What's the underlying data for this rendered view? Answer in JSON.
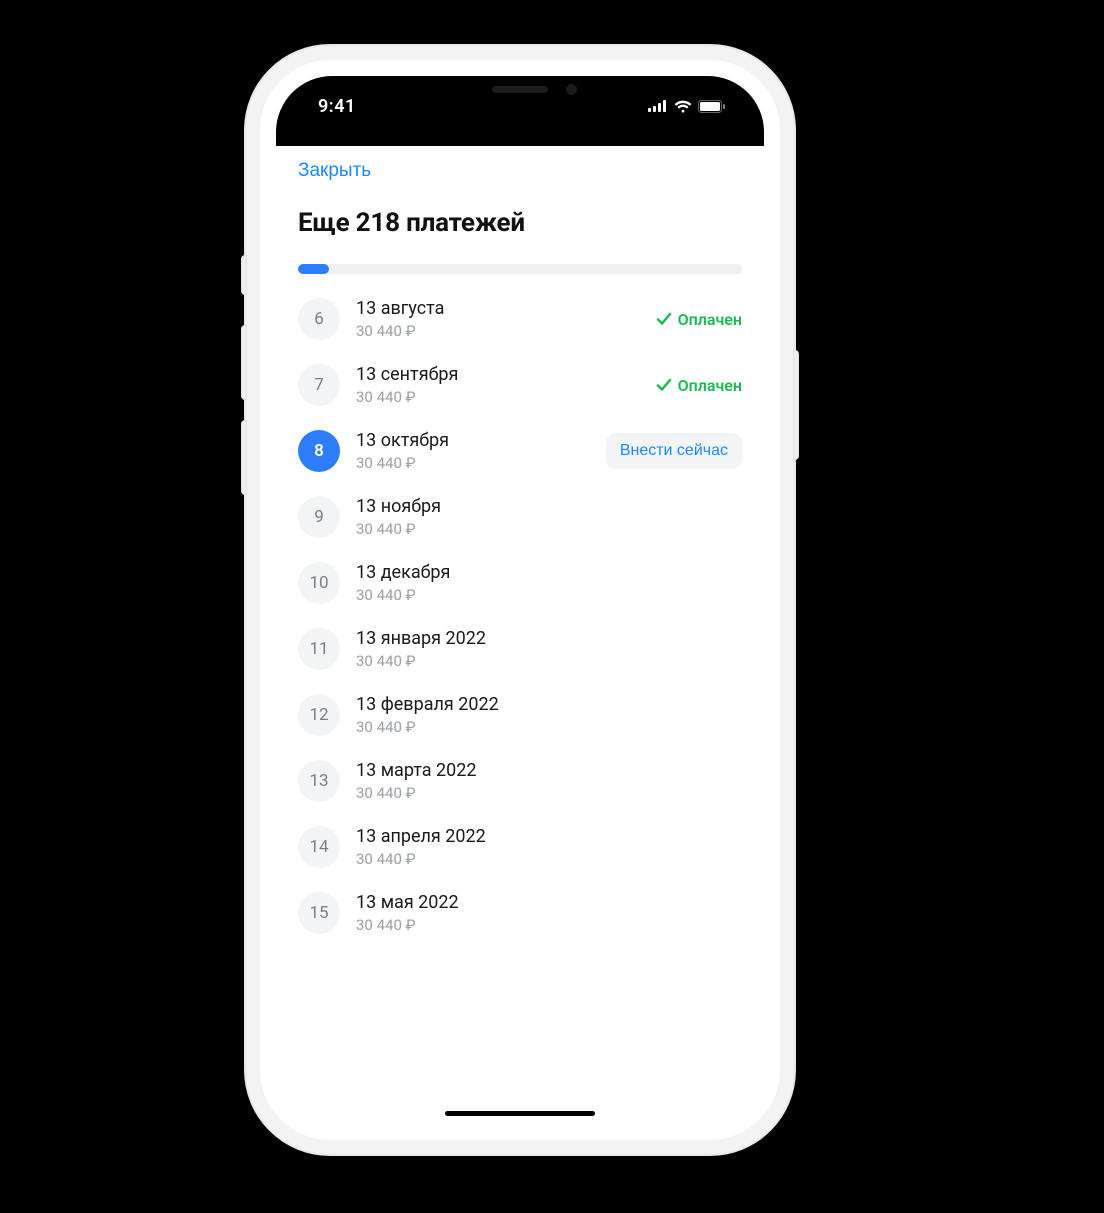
{
  "statusbar": {
    "time": "9:41"
  },
  "nav": {
    "close": "Закрыть"
  },
  "header": {
    "title": "Еще 218 платежей"
  },
  "progress": {
    "percent": 7
  },
  "labels": {
    "paid": "Оплачен",
    "pay_now": "Внести сейчас"
  },
  "payments": [
    {
      "n": "6",
      "date": "13 августа",
      "amount": "30 440 ₽",
      "status": "paid"
    },
    {
      "n": "7",
      "date": "13 сентября",
      "amount": "30 440 ₽",
      "status": "paid"
    },
    {
      "n": "8",
      "date": "13 октября",
      "amount": "30 440 ₽",
      "status": "due",
      "active": true
    },
    {
      "n": "9",
      "date": "13 ноября",
      "amount": "30 440 ₽",
      "status": "future"
    },
    {
      "n": "10",
      "date": "13 декабря",
      "amount": "30 440 ₽",
      "status": "future"
    },
    {
      "n": "11",
      "date": "13 января 2022",
      "amount": "30 440 ₽",
      "status": "future"
    },
    {
      "n": "12",
      "date": "13 февраля 2022",
      "amount": "30 440 ₽",
      "status": "future"
    },
    {
      "n": "13",
      "date": "13 марта 2022",
      "amount": "30 440 ₽",
      "status": "future"
    },
    {
      "n": "14",
      "date": "13 апреля 2022",
      "amount": "30 440 ₽",
      "status": "future"
    },
    {
      "n": "15",
      "date": "13 мая 2022",
      "amount": "30 440 ₽",
      "status": "future"
    }
  ]
}
